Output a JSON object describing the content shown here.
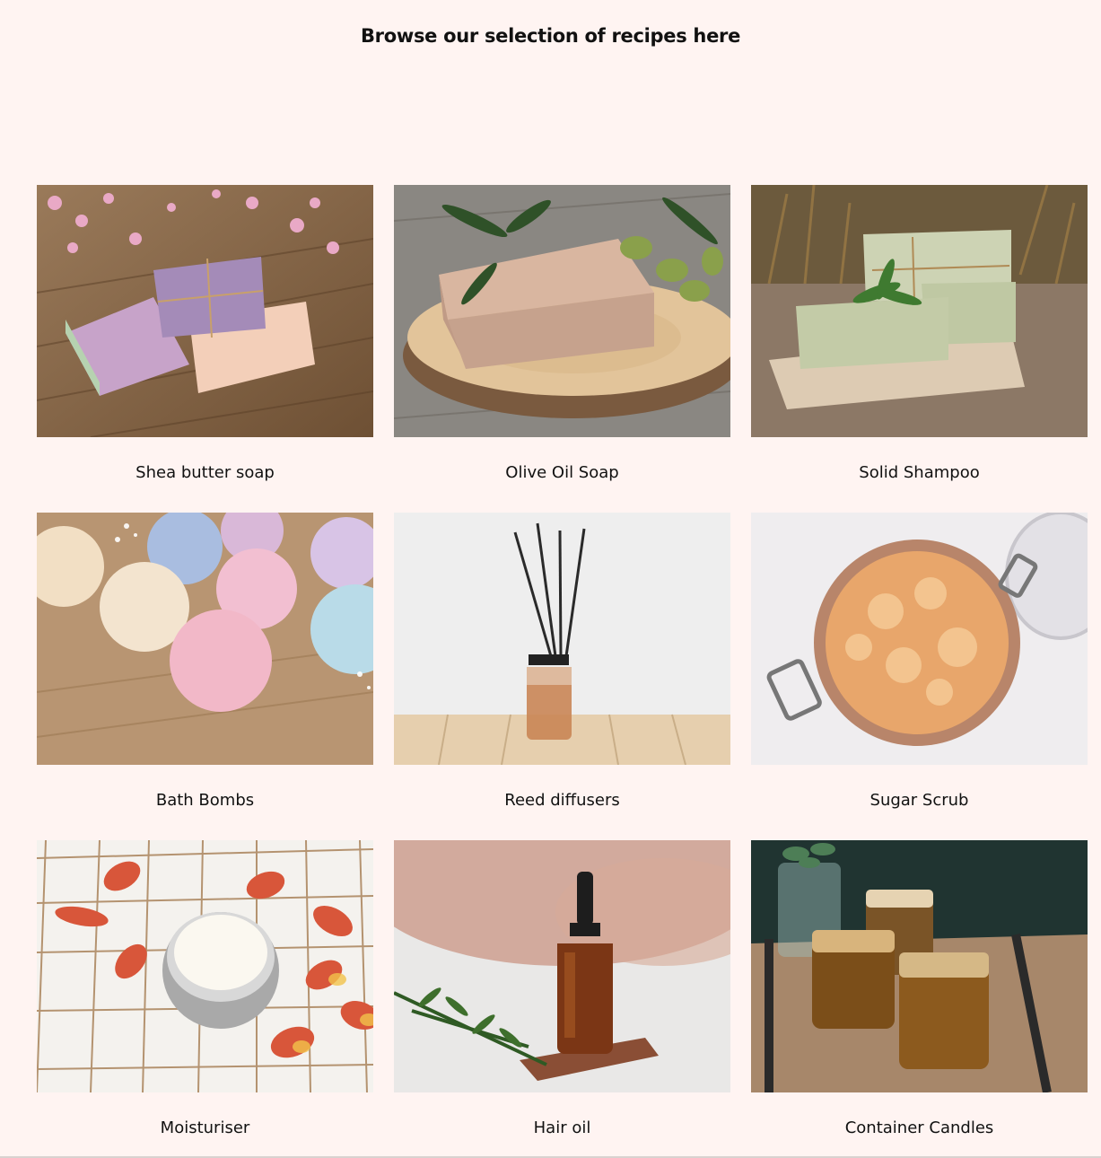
{
  "heading": "Browse our selection of recipes here",
  "recipes": [
    {
      "label": "Shea butter soap",
      "icon": "shea-butter-soap-photo"
    },
    {
      "label": "Olive Oil Soap",
      "icon": "olive-oil-soap-photo"
    },
    {
      "label": "Solid Shampoo",
      "icon": "solid-shampoo-photo"
    },
    {
      "label": "Bath Bombs",
      "icon": "bath-bombs-photo"
    },
    {
      "label": "Reed diffusers",
      "icon": "reed-diffusers-photo"
    },
    {
      "label": "Sugar Scrub",
      "icon": "sugar-scrub-photo"
    },
    {
      "label": "Moisturiser",
      "icon": "moisturiser-photo"
    },
    {
      "label": "Hair oil",
      "icon": "hair-oil-photo"
    },
    {
      "label": "Container Candles",
      "icon": "container-candles-photo"
    }
  ],
  "colors": {
    "background": "#fff4f2",
    "text": "#111111"
  }
}
